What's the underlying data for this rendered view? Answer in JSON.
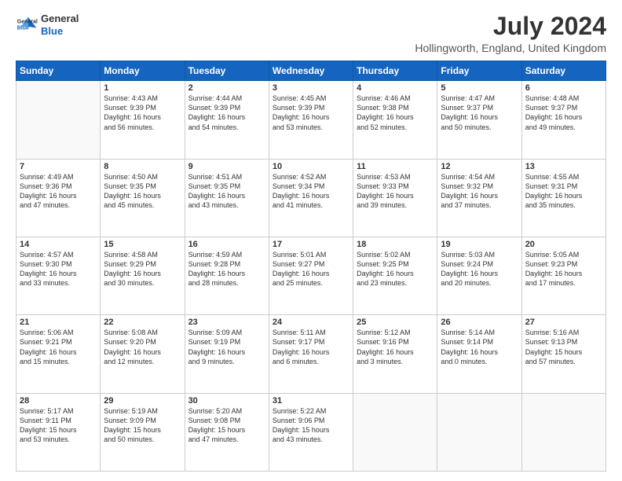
{
  "logo": {
    "line1": "General",
    "line2": "Blue"
  },
  "title": "July 2024",
  "location": "Hollingworth, England, United Kingdom",
  "days_of_week": [
    "Sunday",
    "Monday",
    "Tuesday",
    "Wednesday",
    "Thursday",
    "Friday",
    "Saturday"
  ],
  "weeks": [
    [
      {
        "day": "",
        "info": ""
      },
      {
        "day": "1",
        "info": "Sunrise: 4:43 AM\nSunset: 9:39 PM\nDaylight: 16 hours\nand 56 minutes."
      },
      {
        "day": "2",
        "info": "Sunrise: 4:44 AM\nSunset: 9:39 PM\nDaylight: 16 hours\nand 54 minutes."
      },
      {
        "day": "3",
        "info": "Sunrise: 4:45 AM\nSunset: 9:39 PM\nDaylight: 16 hours\nand 53 minutes."
      },
      {
        "day": "4",
        "info": "Sunrise: 4:46 AM\nSunset: 9:38 PM\nDaylight: 16 hours\nand 52 minutes."
      },
      {
        "day": "5",
        "info": "Sunrise: 4:47 AM\nSunset: 9:37 PM\nDaylight: 16 hours\nand 50 minutes."
      },
      {
        "day": "6",
        "info": "Sunrise: 4:48 AM\nSunset: 9:37 PM\nDaylight: 16 hours\nand 49 minutes."
      }
    ],
    [
      {
        "day": "7",
        "info": "Sunrise: 4:49 AM\nSunset: 9:36 PM\nDaylight: 16 hours\nand 47 minutes."
      },
      {
        "day": "8",
        "info": "Sunrise: 4:50 AM\nSunset: 9:35 PM\nDaylight: 16 hours\nand 45 minutes."
      },
      {
        "day": "9",
        "info": "Sunrise: 4:51 AM\nSunset: 9:35 PM\nDaylight: 16 hours\nand 43 minutes."
      },
      {
        "day": "10",
        "info": "Sunrise: 4:52 AM\nSunset: 9:34 PM\nDaylight: 16 hours\nand 41 minutes."
      },
      {
        "day": "11",
        "info": "Sunrise: 4:53 AM\nSunset: 9:33 PM\nDaylight: 16 hours\nand 39 minutes."
      },
      {
        "day": "12",
        "info": "Sunrise: 4:54 AM\nSunset: 9:32 PM\nDaylight: 16 hours\nand 37 minutes."
      },
      {
        "day": "13",
        "info": "Sunrise: 4:55 AM\nSunset: 9:31 PM\nDaylight: 16 hours\nand 35 minutes."
      }
    ],
    [
      {
        "day": "14",
        "info": "Sunrise: 4:57 AM\nSunset: 9:30 PM\nDaylight: 16 hours\nand 33 minutes."
      },
      {
        "day": "15",
        "info": "Sunrise: 4:58 AM\nSunset: 9:29 PM\nDaylight: 16 hours\nand 30 minutes."
      },
      {
        "day": "16",
        "info": "Sunrise: 4:59 AM\nSunset: 9:28 PM\nDaylight: 16 hours\nand 28 minutes."
      },
      {
        "day": "17",
        "info": "Sunrise: 5:01 AM\nSunset: 9:27 PM\nDaylight: 16 hours\nand 25 minutes."
      },
      {
        "day": "18",
        "info": "Sunrise: 5:02 AM\nSunset: 9:25 PM\nDaylight: 16 hours\nand 23 minutes."
      },
      {
        "day": "19",
        "info": "Sunrise: 5:03 AM\nSunset: 9:24 PM\nDaylight: 16 hours\nand 20 minutes."
      },
      {
        "day": "20",
        "info": "Sunrise: 5:05 AM\nSunset: 9:23 PM\nDaylight: 16 hours\nand 17 minutes."
      }
    ],
    [
      {
        "day": "21",
        "info": "Sunrise: 5:06 AM\nSunset: 9:21 PM\nDaylight: 16 hours\nand 15 minutes."
      },
      {
        "day": "22",
        "info": "Sunrise: 5:08 AM\nSunset: 9:20 PM\nDaylight: 16 hours\nand 12 minutes."
      },
      {
        "day": "23",
        "info": "Sunrise: 5:09 AM\nSunset: 9:19 PM\nDaylight: 16 hours\nand 9 minutes."
      },
      {
        "day": "24",
        "info": "Sunrise: 5:11 AM\nSunset: 9:17 PM\nDaylight: 16 hours\nand 6 minutes."
      },
      {
        "day": "25",
        "info": "Sunrise: 5:12 AM\nSunset: 9:16 PM\nDaylight: 16 hours\nand 3 minutes."
      },
      {
        "day": "26",
        "info": "Sunrise: 5:14 AM\nSunset: 9:14 PM\nDaylight: 16 hours\nand 0 minutes."
      },
      {
        "day": "27",
        "info": "Sunrise: 5:16 AM\nSunset: 9:13 PM\nDaylight: 15 hours\nand 57 minutes."
      }
    ],
    [
      {
        "day": "28",
        "info": "Sunrise: 5:17 AM\nSunset: 9:11 PM\nDaylight: 15 hours\nand 53 minutes."
      },
      {
        "day": "29",
        "info": "Sunrise: 5:19 AM\nSunset: 9:09 PM\nDaylight: 15 hours\nand 50 minutes."
      },
      {
        "day": "30",
        "info": "Sunrise: 5:20 AM\nSunset: 9:08 PM\nDaylight: 15 hours\nand 47 minutes."
      },
      {
        "day": "31",
        "info": "Sunrise: 5:22 AM\nSunset: 9:06 PM\nDaylight: 15 hours\nand 43 minutes."
      },
      {
        "day": "",
        "info": ""
      },
      {
        "day": "",
        "info": ""
      },
      {
        "day": "",
        "info": ""
      }
    ]
  ]
}
